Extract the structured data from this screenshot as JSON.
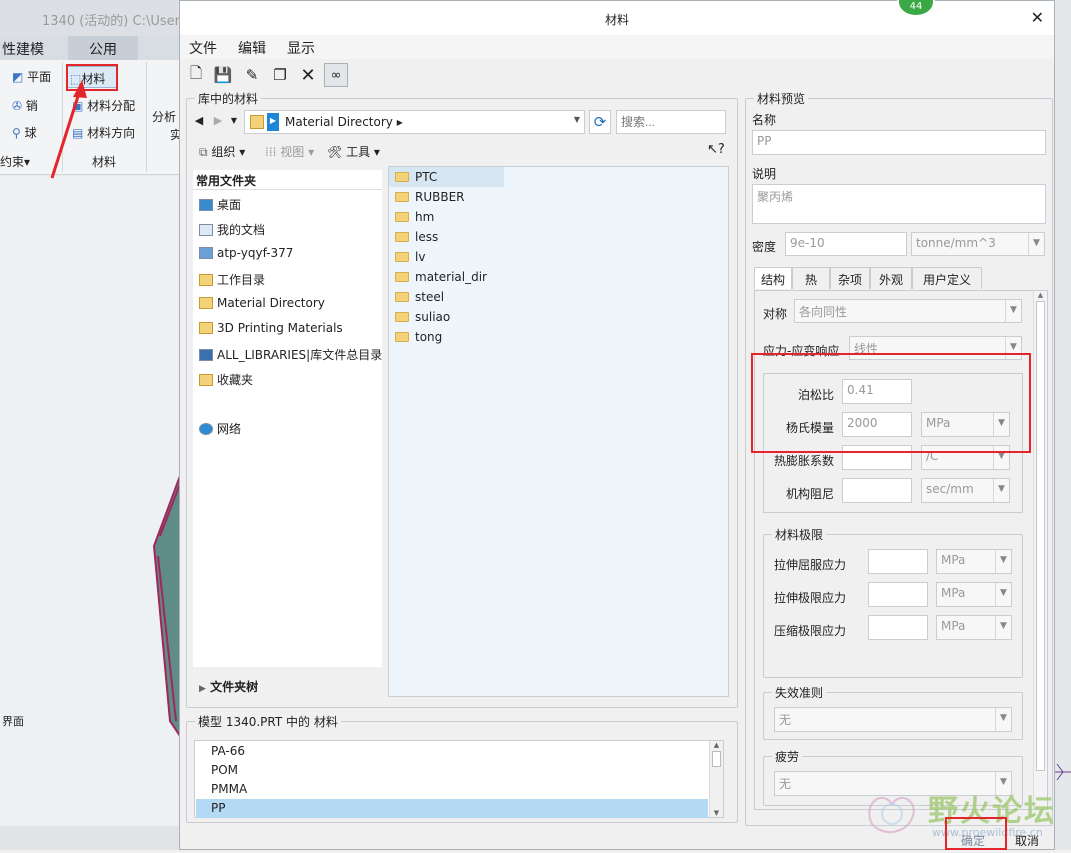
{
  "background_app": {
    "title": "1340 (活动的) C:\\Users",
    "tabs": [
      "性建模",
      "公用"
    ],
    "ribbon": {
      "col1": [
        "平面",
        "销",
        "球"
      ],
      "col1_group": "约束",
      "col2": [
        "材料",
        "材料分配",
        "材料方向"
      ],
      "col2_group": "材料",
      "col3": "分析",
      "col3b": "实"
    },
    "left_label": "界面"
  },
  "dialog": {
    "title": "材料",
    "badge": "44",
    "menu": [
      "文件",
      "编辑",
      "显示"
    ],
    "library": {
      "group_label": "库中的材料",
      "path": "Material Directory",
      "search_placeholder": "搜索...",
      "organize": "组织",
      "view": "视图",
      "tools": "工具",
      "help": "?",
      "favorites_header": "常用文件夹",
      "favorites": [
        "桌面",
        "我的文档",
        "atp-yqyf-377",
        "工作目录",
        "Material Directory",
        "3D Printing Materials",
        "ALL_LIBRARIES|库文件总目录",
        "收藏夹",
        "网络"
      ],
      "folder_tree": "文件夹树",
      "folders": [
        "PTC",
        "RUBBER",
        "hm",
        "less",
        "lv",
        "material_dir",
        "steel",
        "suliao",
        "tong"
      ]
    },
    "model": {
      "group_label": "模型 1340.PRT 中的 材料",
      "materials": [
        "PA-66",
        "POM",
        "PMMA",
        "PP"
      ],
      "selected": "PP"
    },
    "preview": {
      "group_label": "材料预览",
      "name_label": "名称",
      "name_value": "PP",
      "desc_label": "说明",
      "desc_value": "聚丙烯",
      "density_label": "密度",
      "density_value": "9e-10",
      "density_unit": "tonne/mm^3",
      "tabs": [
        "结构",
        "热",
        "杂项",
        "外观",
        "用户定义"
      ],
      "active_tab": "结构",
      "symmetry_label": "对称",
      "symmetry_value": "各向同性",
      "stress_label": "应力-应变响应",
      "stress_value": "线性",
      "poisson_label": "泊松比",
      "poisson_value": "0.41",
      "young_label": "杨氏模量",
      "young_value": "2000",
      "young_unit": "MPa",
      "thermal_label": "热膨胀系数",
      "thermal_unit": "/C",
      "damping_label": "机构阻尼",
      "damping_unit": "sec/mm",
      "limits_label": "材料极限",
      "tensile_yield_label": "拉伸屈服应力",
      "tensile_ultimate_label": "拉伸极限应力",
      "compress_label": "压缩极限应力",
      "limit_unit": "MPa",
      "failure_label": "失效准则",
      "failure_value": "无",
      "fatigue_label": "疲劳",
      "fatigue_value": "无"
    },
    "ok": "确定",
    "cancel": "取消"
  },
  "watermark": {
    "text": "野火论坛",
    "url": "www.proewildfire.cn"
  },
  "colors": {
    "annotation": "#e4262b",
    "selection": "#b3d9f5"
  }
}
